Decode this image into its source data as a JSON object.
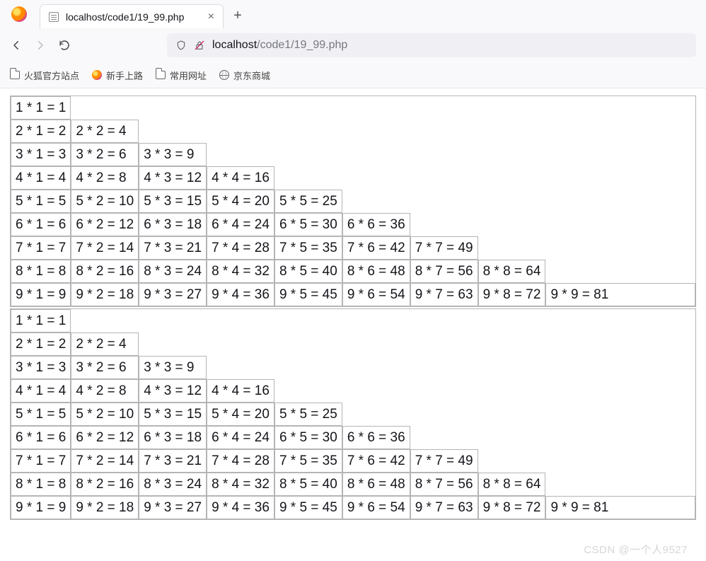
{
  "browser": {
    "tab_title": "localhost/code1/19_99.php",
    "url_host": "localhost",
    "url_path": "/code1/19_99.php",
    "bookmarks": [
      {
        "label": "火狐官方站点",
        "icon": "folder"
      },
      {
        "label": "新手上路",
        "icon": "fox"
      },
      {
        "label": "常用网址",
        "icon": "folder"
      },
      {
        "label": "京东商城",
        "icon": "globe"
      }
    ]
  },
  "content": {
    "tables": 2,
    "max_n": 9,
    "expression_template": "{i} * {j} = {p}"
  },
  "watermark": "CSDN @一个人9527"
}
